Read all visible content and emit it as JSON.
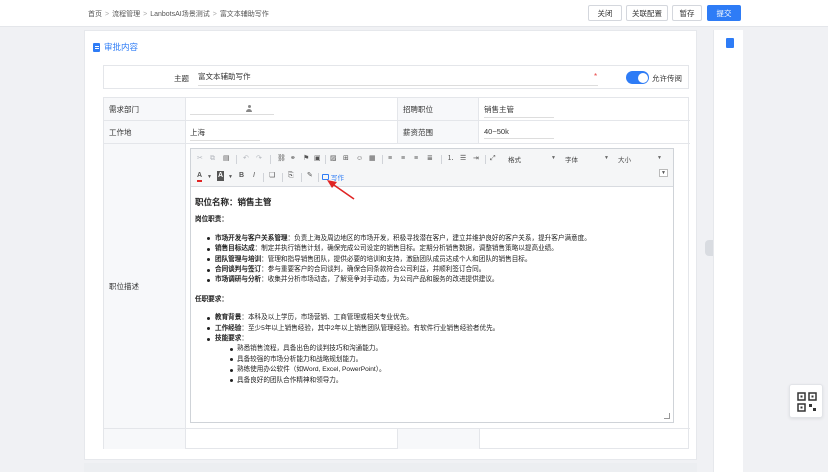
{
  "breadcrumb": [
    "首页",
    "流程管理",
    "LanbotsAI场景测试",
    "富文本辅助写作"
  ],
  "actions": {
    "close": "关闭",
    "link_config": "关联配置",
    "save_draft": "暂存",
    "submit": "提交"
  },
  "section": {
    "title": "审批内容"
  },
  "subject": {
    "label": "主题",
    "value": "富文本辅助写作",
    "required_mark": "*",
    "toggle_label": "允许传阅",
    "toggle_on": true
  },
  "form": {
    "dept_label": "需求部门",
    "position_label": "招聘职位",
    "position_value": "销售主管",
    "workplace_label": "工作地",
    "workplace_value": "上海",
    "salary_label": "薪资范围",
    "salary_value": "40~50k",
    "desc_label": "职位描述"
  },
  "editor": {
    "format_dd": "格式",
    "font_dd": "字体",
    "size_dd": "大小",
    "write_btn": "写作"
  },
  "doc": {
    "title": "职位名称：销售主管",
    "duties_heading": "岗位职责：",
    "duties": [
      {
        "b": "市场开发与客户关系管理",
        "t": "：负责上海及周边地区的市场开发，积极寻找潜在客户，建立并维护良好的客户关系，提升客户满意度。"
      },
      {
        "b": "销售目标达成",
        "t": "：制定并执行销售计划，确保完成公司设定的销售目标。定期分析销售数据，调整销售策略以提高业绩。"
      },
      {
        "b": "团队管理与培训",
        "t": "：管理和指导销售团队，提供必要的培训和支持，激励团队成员达成个人和团队的销售目标。"
      },
      {
        "b": "合同谈判与签订",
        "t": "：参与重要客户的合同谈判，确保合同条款符合公司利益，并顺利签订合同。"
      },
      {
        "b": "市场调研与分析",
        "t": "：收集并分析市场动态，了解竞争对手动态，为公司产品和服务的改进提供建议。"
      }
    ],
    "req_heading": "任职要求：",
    "reqs": [
      {
        "b": "教育背景",
        "t": "：本科及以上学历，市场营销、工商管理或相关专业优先。"
      },
      {
        "b": "工作经验",
        "t": "：至少5年以上销售经验，其中2年以上销售团队管理经验。有软件行业销售经验者优先。"
      },
      {
        "b": "技能要求",
        "t": "："
      }
    ],
    "skills": [
      "熟悉销售流程，具备出色的谈判技巧和沟通能力。",
      "具备较强的市场分析能力和战略规划能力。",
      "熟练使用办公软件（如Word, Excel, PowerPoint）。",
      "具备良好的团队合作精神和领导力。"
    ]
  },
  "colors": {
    "accent": "#2e7cf6",
    "arrow": "#e02424"
  }
}
